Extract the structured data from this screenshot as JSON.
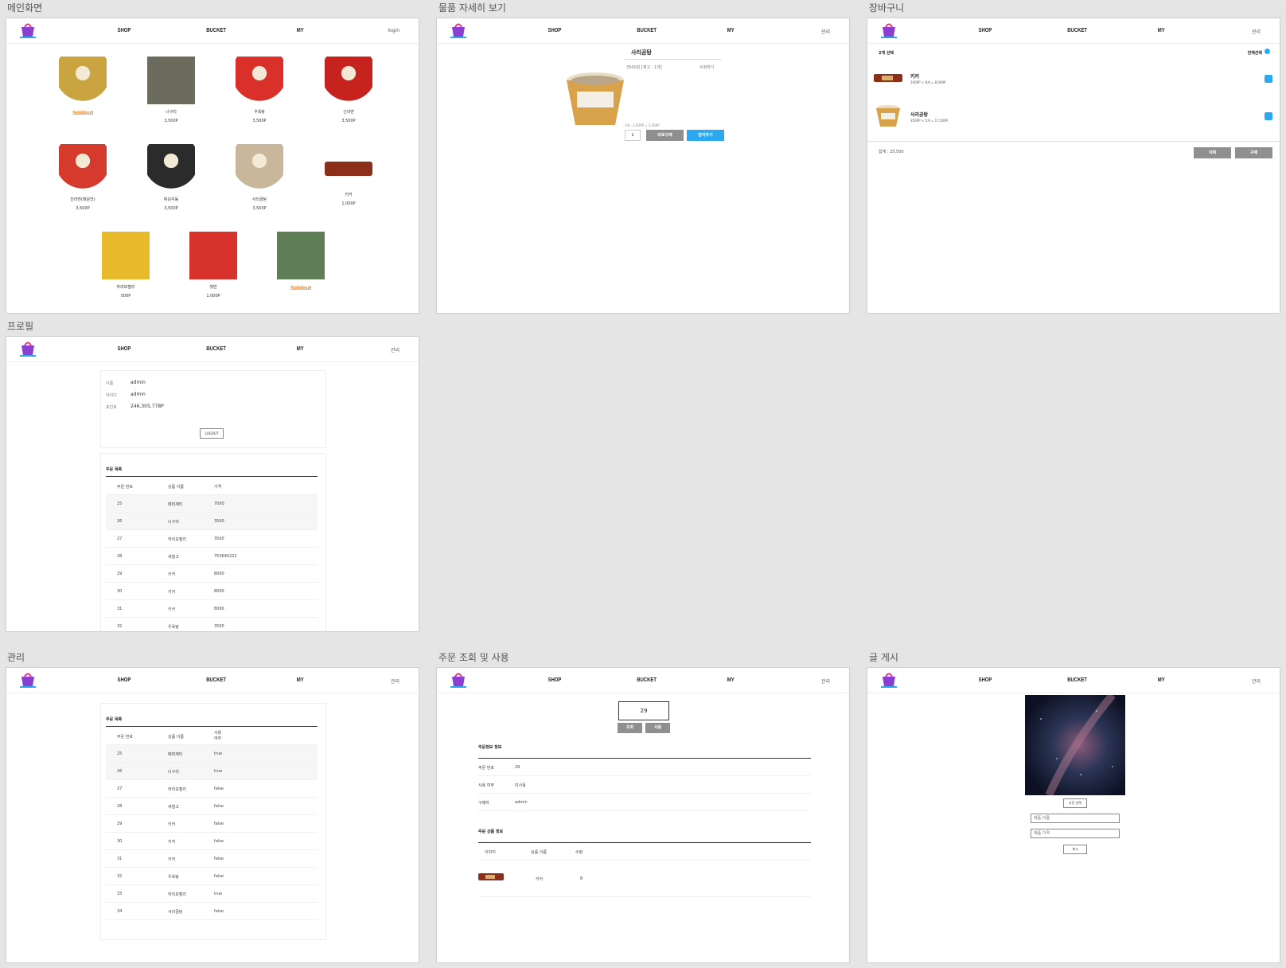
{
  "nav": {
    "shop": "SHOP",
    "bucket": "BUCKET",
    "my": "MY",
    "login": "login",
    "admin": "관리",
    "logo_text": "T SHOP",
    "logo_sub": "PUBG STUDIO"
  },
  "frames": {
    "main": "메인화면",
    "detail": "물품 자세히 보기",
    "cart": "장바구니",
    "profile": "프로필",
    "manage": "관리",
    "order": "주문 조회 및 사용",
    "post": "글 게시"
  },
  "main": {
    "soldout": "Soldout",
    "products": [
      {
        "name": "",
        "price": "",
        "soldout": true,
        "icon": "ramen-cup-icon",
        "color": "#c9a441"
      },
      {
        "name": "너구리",
        "price": "3,500P",
        "soldout": false,
        "icon": "raccoon-photo-icon",
        "color": "#6b6b5e"
      },
      {
        "name": "우육탕",
        "price": "3,500P",
        "soldout": false,
        "icon": "ramen-cup-icon",
        "color": "#d9302a"
      },
      {
        "name": "신라면",
        "price": "3,500P",
        "soldout": false,
        "icon": "ramen-cup-icon",
        "color": "#c6231e"
      },
      {
        "name": "진라면(매운맛)",
        "price": "3,500P",
        "soldout": false,
        "icon": "ramen-cup-icon",
        "color": "#d63a2c"
      },
      {
        "name": "튀김우동",
        "price": "3,500P",
        "soldout": false,
        "icon": "ramen-cup-icon",
        "color": "#2b2b2b"
      },
      {
        "name": "사리곰탕",
        "price": "3,500P",
        "soldout": false,
        "icon": "ramen-cup-icon",
        "color": "#c9b79c"
      },
      {
        "name": "키커",
        "price": "1,000P",
        "soldout": false,
        "icon": "chocolate-bar-icon",
        "color": "#8b2f1a"
      },
      {
        "name": "하리보젤리",
        "price": "500P",
        "soldout": false,
        "icon": "haribo-bag-icon",
        "color": "#e8b92a"
      },
      {
        "name": "햇반",
        "price": "1,000P",
        "soldout": false,
        "icon": "rice-pack-icon",
        "color": "#d7322b"
      },
      {
        "name": "",
        "price": "",
        "soldout": true,
        "icon": "campus-photo-icon",
        "color": "#5f7d57"
      }
    ]
  },
  "detail": {
    "name": "사리곰탕",
    "price_stock": "3500원 [재고 : 1개]",
    "edit": "수정하기",
    "summary": "1개 · 3,500P = 3,500P",
    "qty": "1",
    "buy": "바로구매",
    "cart": "담아두기"
  },
  "cart": {
    "count": "2개 선택",
    "select_all": "전체선택",
    "items": [
      {
        "name": "키커",
        "desc": "1000P × 8개 = 8,000P"
      },
      {
        "name": "사리곰탕",
        "desc": "3500P × 5개 = 17,500P"
      }
    ],
    "total": "합계 : 25,500",
    "delete": "삭제",
    "buy": "구매"
  },
  "profile": {
    "name_label": "이름",
    "name": "admin",
    "id_label": "아이디",
    "id": "admin",
    "point_label": "포인트",
    "point": "246,305,778P",
    "logout": "LOGOUT",
    "order_title": "주문 목록",
    "headers": [
      "주문 번호",
      "상품 이름",
      "가격"
    ],
    "rows": [
      [
        "25",
        "페퍼제티",
        "7000"
      ],
      [
        "26",
        "너구리",
        "3500"
      ],
      [
        "27",
        "하리보젤리",
        "3500"
      ],
      [
        "28",
        "새털고",
        "753640222"
      ],
      [
        "29",
        "키커",
        "8000"
      ],
      [
        "30",
        "키커",
        "8000"
      ],
      [
        "31",
        "키커",
        "8000"
      ],
      [
        "32",
        "우육탕",
        "3500"
      ]
    ]
  },
  "manage": {
    "order_title": "주문 목록",
    "headers": [
      "주문 번호",
      "상품 이름",
      "사용\n여부"
    ],
    "rows": [
      [
        "25",
        "페퍼제티",
        "true"
      ],
      [
        "26",
        "너구리",
        "true"
      ],
      [
        "27",
        "하리보젤리",
        "false"
      ],
      [
        "28",
        "새털고",
        "false"
      ],
      [
        "29",
        "키커",
        "false"
      ],
      [
        "30",
        "키커",
        "false"
      ],
      [
        "31",
        "키커",
        "false"
      ],
      [
        "32",
        "우육탕",
        "false"
      ],
      [
        "33",
        "하리보젤리",
        "true"
      ],
      [
        "34",
        "사리곰탕",
        "false"
      ]
    ]
  },
  "order": {
    "input": "29",
    "search": "조회",
    "use": "사용",
    "info_title": "주문정보 정보",
    "info": [
      {
        "label": "주문 번호",
        "value": "29"
      },
      {
        "label": "사용 여부",
        "value": "미사용"
      },
      {
        "label": "구매자",
        "value": "admin"
      }
    ],
    "product_title": "주문 상품 정보",
    "headers": [
      "이미지",
      "상품 이름",
      "수량"
    ],
    "product": {
      "name": "키커",
      "qty": "8"
    }
  },
  "post": {
    "select_photo": "사진 선택",
    "name_placeholder": "제품 이름",
    "price_placeholder": "제품 가격",
    "submit": "게시"
  }
}
